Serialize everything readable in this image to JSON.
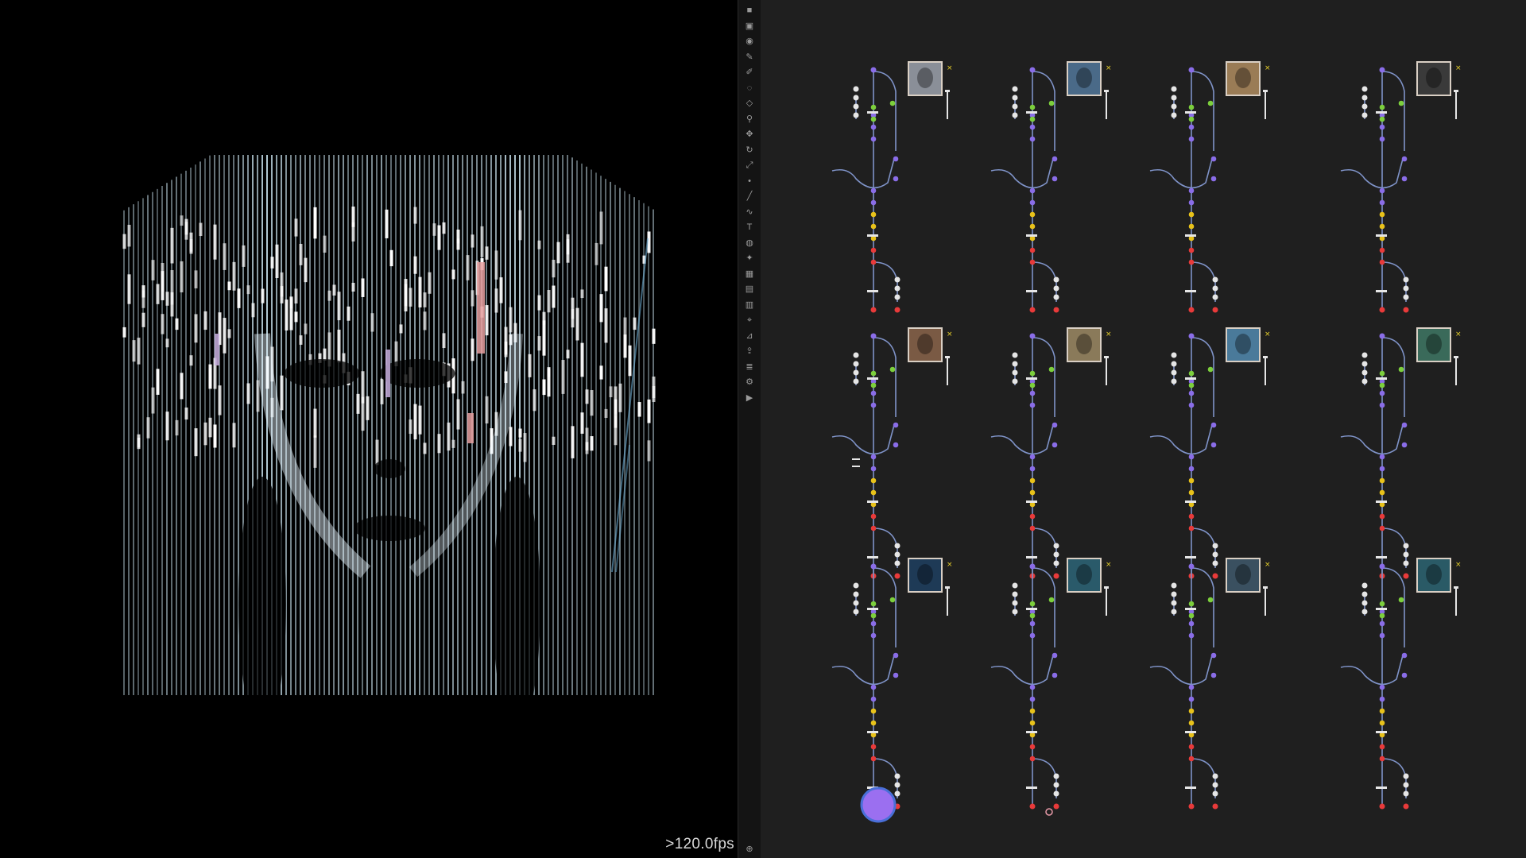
{
  "viewport": {
    "fps_label": ">120.0fps",
    "render": {
      "subject": "stylized-female-face-line-scan",
      "line_color": "#cfe9f5",
      "accent_colors": [
        "#e8a0a0",
        "#c9b0e0"
      ]
    }
  },
  "toolbar": {
    "tools": [
      "lock-icon",
      "select-icon",
      "node-icon",
      "pen-icon",
      "brush-icon",
      "eraser-icon",
      "shape-icon",
      "link-icon",
      "move-icon",
      "rotate-icon",
      "scale-icon",
      "dot-icon",
      "line-icon",
      "curve-icon",
      "text-icon",
      "camera-icon",
      "light-icon",
      "mesh-icon",
      "grid-icon",
      "fill-icon",
      "measure-icon",
      "pin-icon",
      "export-icon",
      "layers-icon",
      "settings-icon",
      "play-icon"
    ]
  },
  "graph": {
    "colors": {
      "wire": "#7f93c8",
      "purple": "#8a6de8",
      "green": "#7ccf3c",
      "yellow": "#e8c21a",
      "red": "#e83a3a",
      "white": "#e6e6e6",
      "output": "#9b6ff0",
      "frame": "#d9cfc4",
      "marker_yellow": "#e8d02a"
    },
    "node_groups": [
      {
        "id": "g1",
        "thumbnail": "portrait-thumb-1",
        "tone": "#8a8f98"
      },
      {
        "id": "g2",
        "thumbnail": "portrait-thumb-2",
        "tone": "#4a6a88"
      },
      {
        "id": "g3",
        "thumbnail": "portrait-thumb-3",
        "tone": "#9a7c56"
      },
      {
        "id": "g4",
        "thumbnail": "portrait-thumb-4",
        "tone": "#3a3a3a"
      },
      {
        "id": "g5",
        "thumbnail": "portrait-thumb-5",
        "tone": "#7a5a44"
      },
      {
        "id": "g6",
        "thumbnail": "portrait-thumb-6",
        "tone": "#8a7a5a"
      },
      {
        "id": "g7",
        "thumbnail": "portrait-thumb-7",
        "tone": "#4a7a9a"
      },
      {
        "id": "g8",
        "thumbnail": "portrait-thumb-8",
        "tone": "#3a6a5a"
      },
      {
        "id": "g9",
        "thumbnail": "portrait-thumb-9",
        "tone": "#1e3a56"
      },
      {
        "id": "g10",
        "thumbnail": "portrait-thumb-10",
        "tone": "#2a5a6a"
      },
      {
        "id": "g11",
        "thumbnail": "portrait-thumb-11",
        "tone": "#3a5060"
      },
      {
        "id": "g12",
        "thumbnail": "portrait-thumb-12",
        "tone": "#2a5a66"
      }
    ]
  }
}
